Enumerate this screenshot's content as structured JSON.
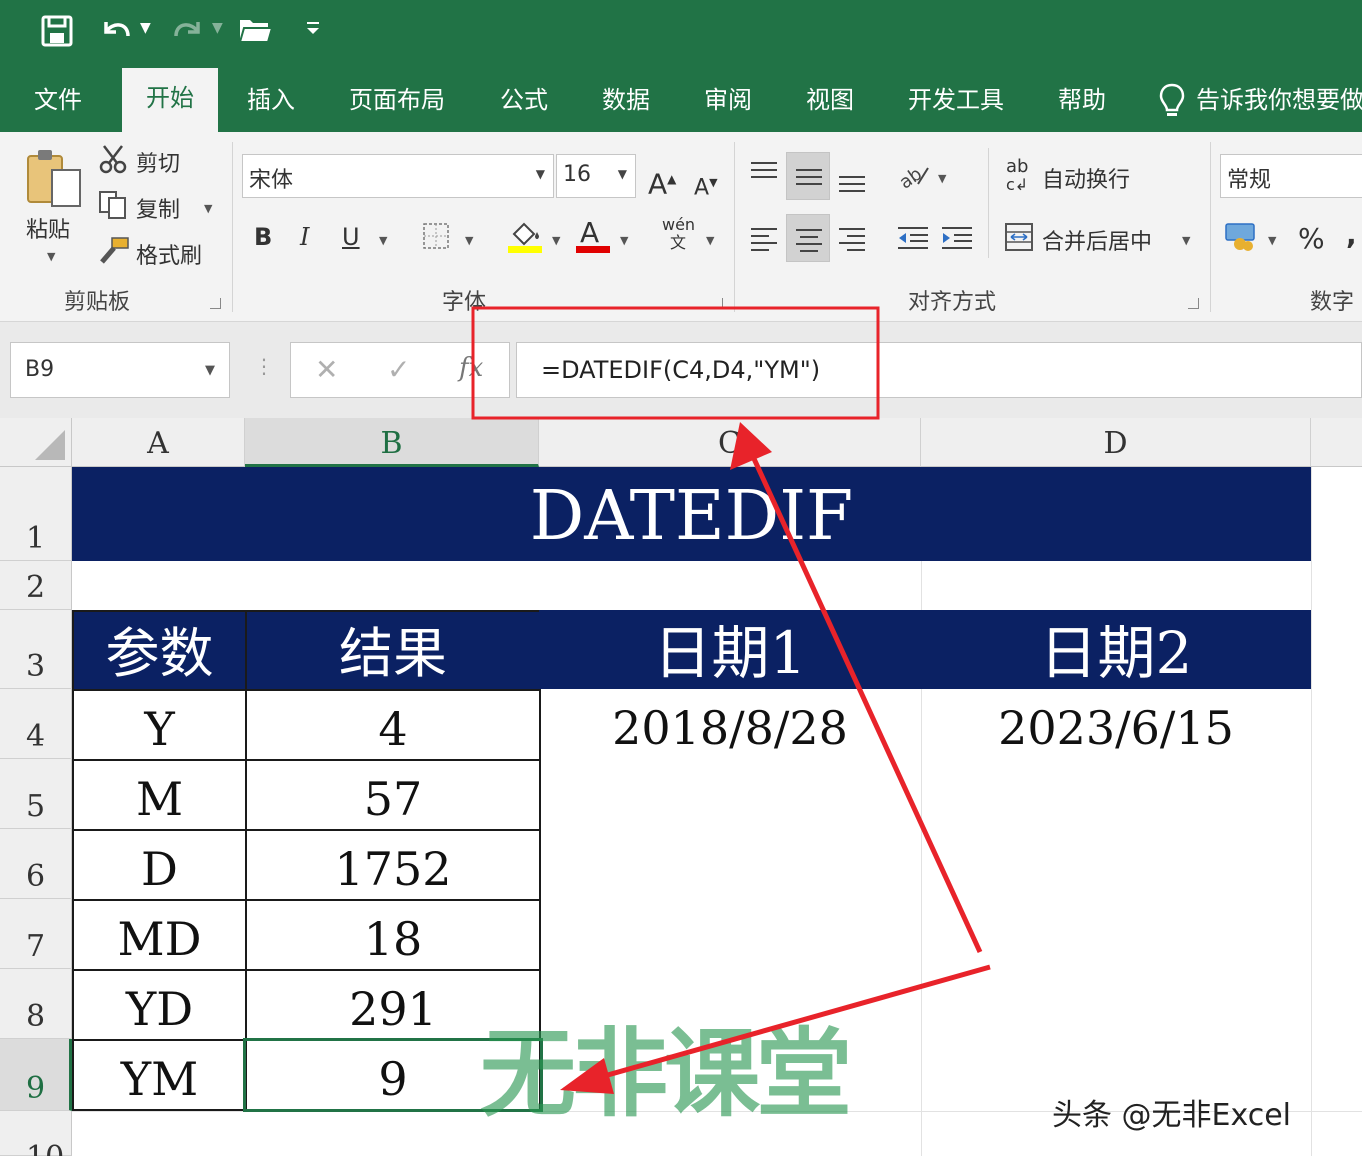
{
  "quick_access": {
    "icons": [
      "save-icon",
      "undo-icon",
      "redo-icon",
      "open-folder-icon",
      "customize-icon"
    ]
  },
  "tabs": [
    {
      "label": "文件"
    },
    {
      "label": "开始",
      "active": true
    },
    {
      "label": "插入"
    },
    {
      "label": "页面布局"
    },
    {
      "label": "公式"
    },
    {
      "label": "数据"
    },
    {
      "label": "审阅"
    },
    {
      "label": "视图"
    },
    {
      "label": "开发工具"
    },
    {
      "label": "帮助"
    },
    {
      "label": "告诉我你想要做"
    }
  ],
  "ribbon": {
    "clipboard": {
      "paste": "粘贴",
      "cut": "剪切",
      "copy": "复制",
      "format_painter": "格式刷",
      "group_label": "剪贴板"
    },
    "font": {
      "font_name": "宋体",
      "font_size": "16",
      "bold": "B",
      "italic": "I",
      "underline": "U",
      "phonetic": "wén",
      "phonetic_sub": "文",
      "group_label": "字体",
      "fill_color": "#ffff00",
      "font_color": "#e00000"
    },
    "alignment": {
      "wrap_text": "自动换行",
      "merge_center": "合并后居中",
      "wrap_icon_text": "ab",
      "group_label": "对齐方式"
    },
    "number": {
      "format": "常规",
      "percent": "%",
      "comma": ",",
      "group_label": "数字"
    }
  },
  "formula_bar": {
    "name_box": "B9",
    "cancel": "✕",
    "enter": "✓",
    "fx": "fx",
    "formula": "=DATEDIF(C4,D4,\"YM\")"
  },
  "columns": [
    "A",
    "B",
    "C",
    "D"
  ],
  "rows": [
    "1",
    "2",
    "3",
    "4",
    "5",
    "6",
    "7",
    "8",
    "9",
    "10"
  ],
  "sheet": {
    "title": "DATEDIF",
    "headers": [
      "参数",
      "结果",
      "日期1",
      "日期2"
    ],
    "table": [
      {
        "param": "Y",
        "result": "4"
      },
      {
        "param": "M",
        "result": "57"
      },
      {
        "param": "D",
        "result": "1752"
      },
      {
        "param": "MD",
        "result": "18"
      },
      {
        "param": "YD",
        "result": "291"
      },
      {
        "param": "YM",
        "result": "9"
      }
    ],
    "date1": "2018/8/28",
    "date2": "2023/6/15"
  },
  "watermark": "无非课堂",
  "credit": "头条 @无非Excel",
  "colors": {
    "excel_green": "#217346",
    "banner_navy": "#0b2163",
    "annotation_red": "#e8232a"
  }
}
